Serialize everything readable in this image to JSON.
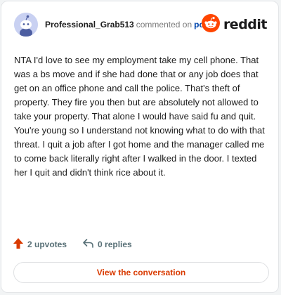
{
  "header": {
    "username": "Professional_Grab513",
    "action_text": "commented on",
    "post_link": "post",
    "logo_word": "reddit"
  },
  "comment": {
    "body": "NTA I'd love to see my employment take my cell phone. That was a bs move and if she had done that or any job does that get on an office phone and call the police. That's theft of property. They fire you then but are absolutely not allowed to take your property. That alone I would have said fu and quit. You're young so I understand not knowing what to do with that threat. I quit a job after I got home and the manager called me to come back literally right after I walked in the door. I texted her I quit and didn't think rice about it."
  },
  "actions": {
    "upvotes_label": "2 upvotes",
    "replies_label": "0 replies"
  },
  "cta": {
    "label": "View the conversation"
  },
  "icons": {
    "avatar": "snoo-avatar-icon",
    "logo": "reddit-snoo-icon",
    "upvote": "upvote-arrow-icon",
    "reply": "reply-arrow-icon"
  },
  "colors": {
    "brand": "#ff4500",
    "link": "#0045ac",
    "cta_text": "#d93a00",
    "muted": "#576f76"
  }
}
